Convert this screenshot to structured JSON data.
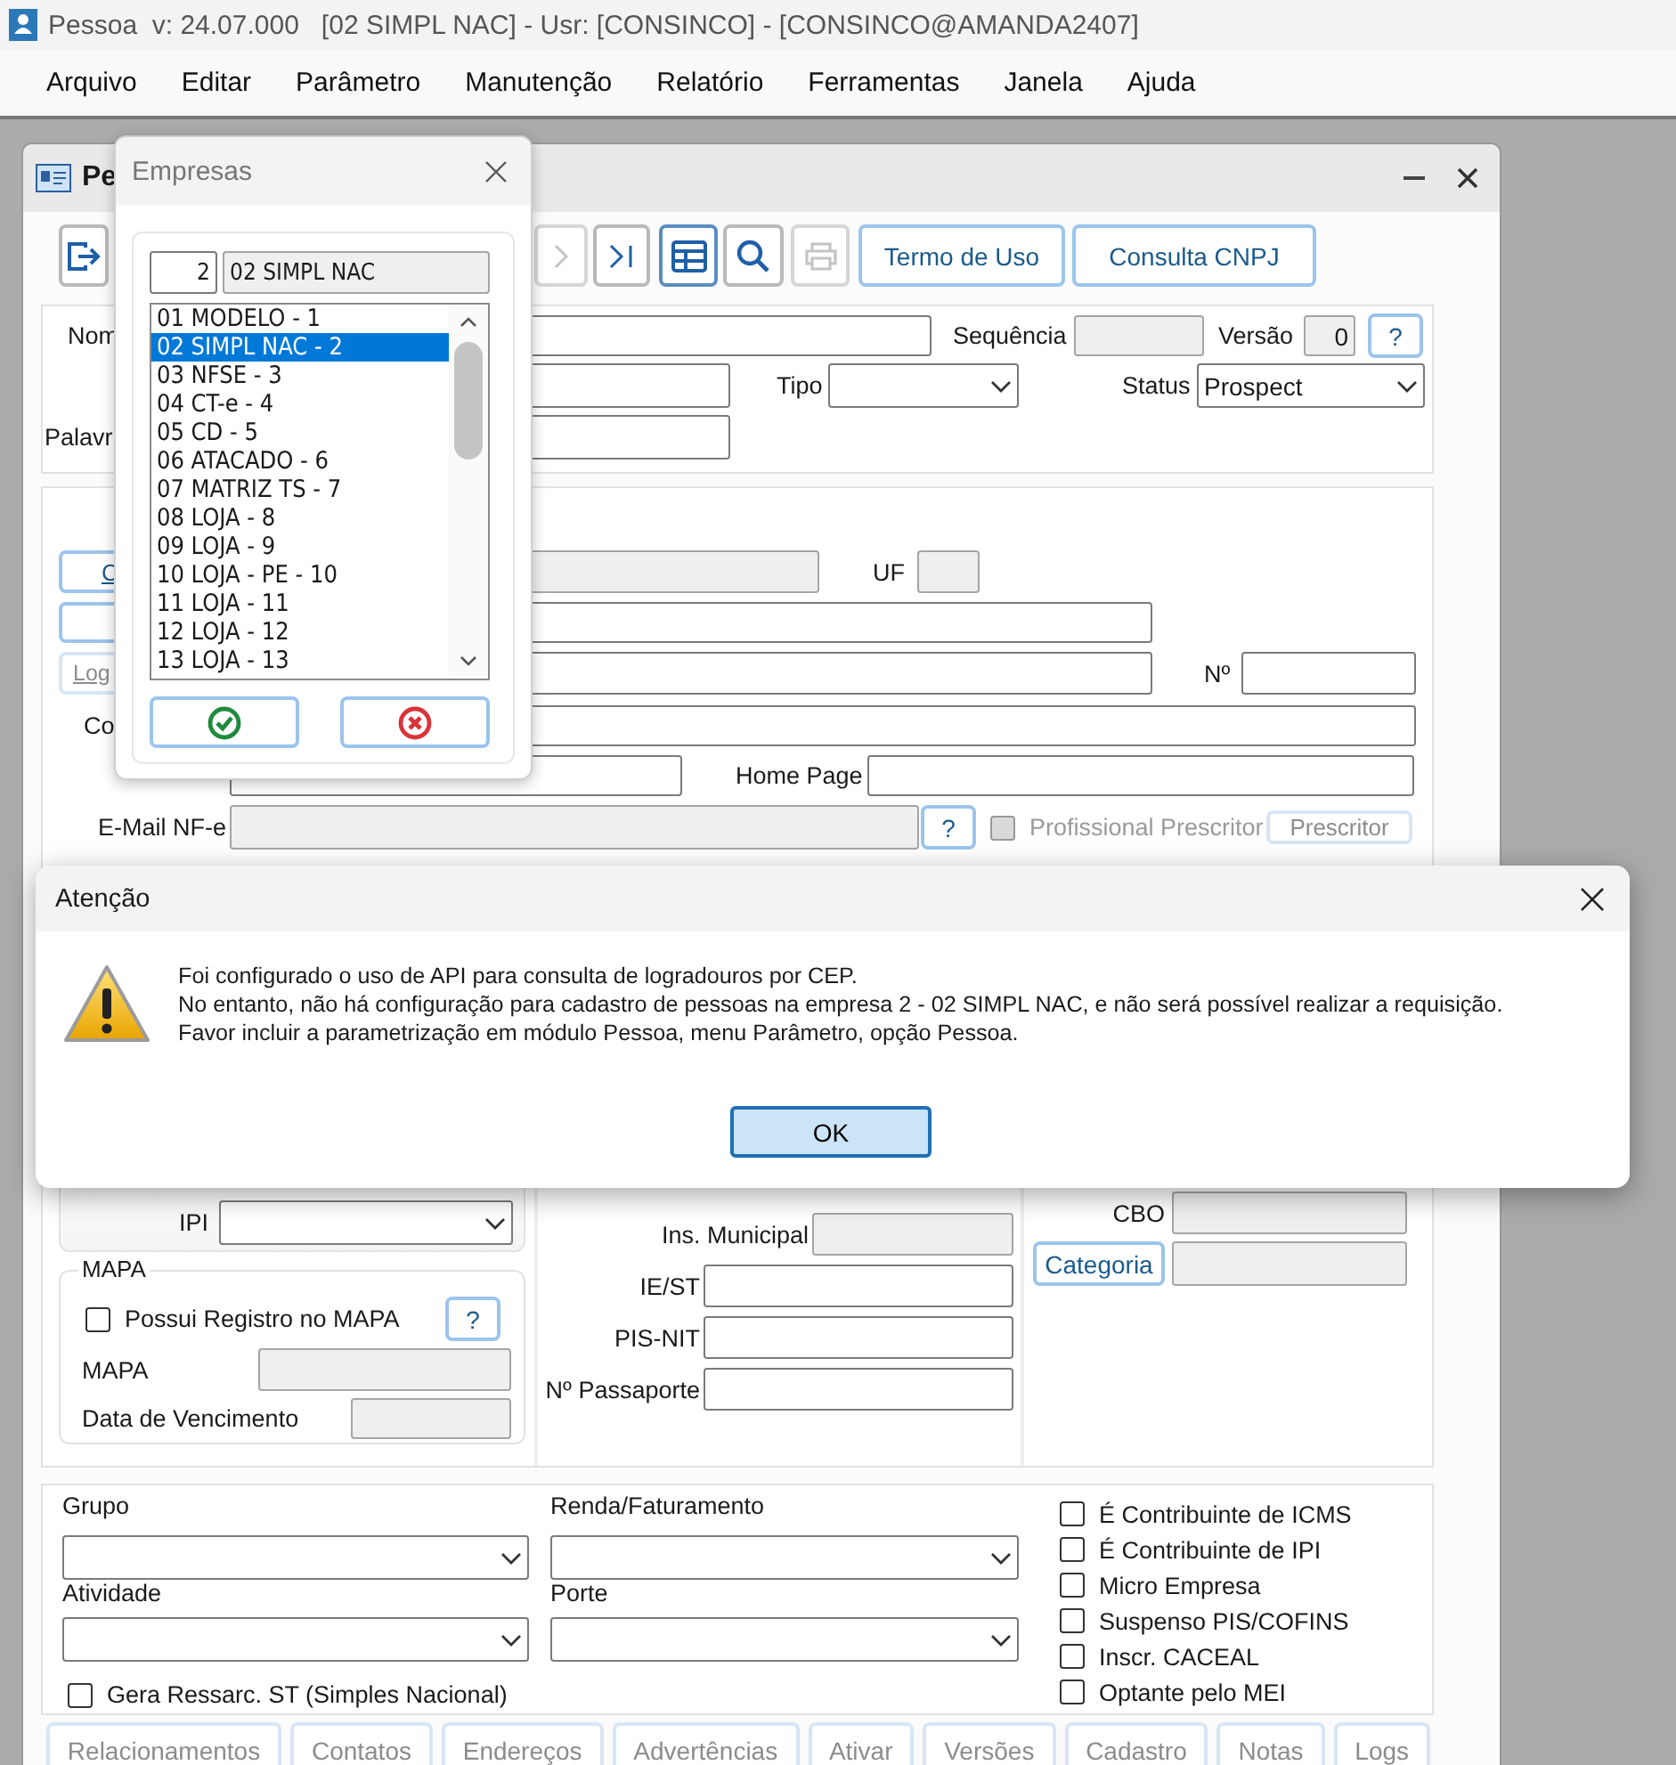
{
  "app": {
    "title": "Pessoa  v: 24.07.000   [02 SIMPL NAC] - Usr: [CONSINCO] - [CONSINCO@AMANDA2407]"
  },
  "menu": [
    "Arquivo",
    "Editar",
    "Parâmetro",
    "Manutenção",
    "Relatório",
    "Ferramentas",
    "Janela",
    "Ajuda"
  ],
  "pessoa_window": {
    "title": "Pe",
    "toolbar": [
      {
        "kind": "exit",
        "disabled": false
      },
      {
        "kind": "next",
        "disabled": true
      },
      {
        "kind": "last",
        "disabled": false
      },
      {
        "kind": "grid",
        "disabled": false
      },
      {
        "kind": "search",
        "disabled": false
      },
      {
        "kind": "print",
        "disabled": true
      }
    ],
    "toolbar_buttons": [
      "Termo de Uso",
      "Consulta CNPJ"
    ],
    "header": {
      "name": {
        "label": "Nom",
        "disabled": false
      },
      "sequence": {
        "label": "Sequência",
        "disabled": true
      },
      "version": {
        "label": "Versão",
        "value": "0",
        "disabled": true
      },
      "help": "?",
      "type": {
        "label": "Tipo"
      },
      "status": {
        "label": "Status",
        "value": "Prospect"
      },
      "keywords": {
        "label": "Palavr",
        "disabled": false
      }
    },
    "address": {
      "side_buttons": [
        {
          "label": "C",
          "disabled": false
        },
        {
          "disabled": false
        },
        {
          "label": "Log",
          "disabled": true
        }
      ],
      "street": {
        "disabled": true
      },
      "uf": {
        "label": "UF",
        "disabled": true
      },
      "number": {
        "label": "Nº"
      },
      "complement": {
        "label": "Co"
      },
      "homepage": {
        "label": "Home Page"
      },
      "nfe_email": {
        "label": "E-Mail NF-e",
        "disabled": true
      },
      "nfe_help": "?",
      "prescriber_check": {
        "label": "Profissional Prescritor",
        "checked": false,
        "disabled": true
      },
      "prescriber_button": {
        "label": "Prescritor",
        "disabled": true
      }
    },
    "ipi": {
      "label": "IPI"
    },
    "mapa": {
      "title": "MAPA",
      "registry": {
        "label": "Possui Registro no MAPA",
        "checked": false
      },
      "help": "?",
      "fields": [
        {
          "label": "MAPA",
          "disabled": true
        },
        {
          "label": "Data de Vencimento",
          "disabled": true
        }
      ]
    },
    "documents": [
      {
        "label": "Ins. Municipal",
        "disabled": true
      },
      {
        "label": "IE/ST",
        "disabled": false
      },
      {
        "label": "PIS-NIT",
        "disabled": false
      },
      {
        "label": "Nº Passaporte",
        "disabled": false
      }
    ],
    "cbo": {
      "label": "CBO",
      "disabled": true
    },
    "category_button": "Categoria",
    "category_field": {
      "disabled": true
    },
    "selects": [
      {
        "label": "Grupo"
      },
      {
        "label": "Renda/Faturamento"
      },
      {
        "label": "Atividade"
      },
      {
        "label": "Porte"
      }
    ],
    "st_refund": {
      "label": "Gera Ressarc. ST (Simples Nacional)",
      "checked": false
    },
    "flags": [
      {
        "label": "É Contribuinte de ICMS",
        "checked": false
      },
      {
        "label": "É Contribuinte de IPI",
        "checked": false
      },
      {
        "label": "Micro Empresa",
        "checked": false
      },
      {
        "label": "Suspenso PIS/COFINS",
        "checked": false
      },
      {
        "label": "Inscr. CACEAL",
        "checked": false
      },
      {
        "label": "Optante pelo MEI",
        "checked": false
      }
    ],
    "tabs": [
      {
        "label": "Relacionamentos",
        "disabled": true
      },
      {
        "label": "Contatos",
        "disabled": true
      },
      {
        "label": "Endereços",
        "disabled": true
      },
      {
        "label": "Advertências",
        "disabled": true
      },
      {
        "label": "Ativar",
        "disabled": true
      },
      {
        "label": "Versões",
        "disabled": true
      },
      {
        "label": "Cadastro",
        "disabled": true
      },
      {
        "label": "Notas",
        "disabled": true
      },
      {
        "label": "Logs",
        "disabled": true
      }
    ]
  },
  "empresas_window": {
    "title": "Empresas",
    "code": "2",
    "name": {
      "value": "02 SIMPL NAC",
      "disabled": true
    },
    "items": [
      {
        "label": "01 MODELO - 1",
        "selected": false
      },
      {
        "label": "02 SIMPL NAC - 2",
        "selected": true
      },
      {
        "label": "03 NFSE - 3",
        "selected": false
      },
      {
        "label": "04 CT-e - 4",
        "selected": false
      },
      {
        "label": "05 CD - 5",
        "selected": false
      },
      {
        "label": "06 ATACADO - 6",
        "selected": false
      },
      {
        "label": "07 MATRIZ TS - 7",
        "selected": false
      },
      {
        "label": "08 LOJA - 8",
        "selected": false
      },
      {
        "label": "09 LOJA - 9",
        "selected": false
      },
      {
        "label": "10 LOJA - PE - 10",
        "selected": false
      },
      {
        "label": "11 LOJA - 11",
        "selected": false
      },
      {
        "label": "12 LOJA - 12",
        "selected": false
      },
      {
        "label": "13 LOJA - 13",
        "selected": false
      }
    ]
  },
  "alert": {
    "title": "Atenção",
    "lines": [
      "Foi configurado o uso de API para consulta de logradouros por CEP.",
      "No entanto, não há configuração para cadastro de pessoas na empresa 2 - 02 SIMPL NAC, e não será possível realizar a requisição.",
      "Favor incluir a parametrização em módulo Pessoa, menu Parâmetro, opção Pessoa."
    ],
    "ok": "OK"
  }
}
